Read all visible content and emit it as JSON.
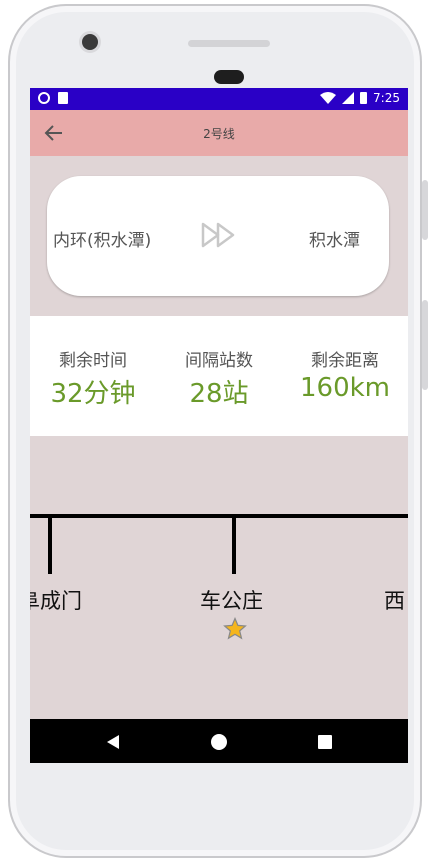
{
  "status_bar": {
    "time": "7:25",
    "icons": [
      "notification-dot-icon",
      "sd-card-icon",
      "wifi-icon",
      "signal-icon",
      "battery-icon"
    ]
  },
  "app_bar": {
    "title": "2号线",
    "back_icon": "arrow-left-icon"
  },
  "route": {
    "from": "内环(积水潭)",
    "to": "积水潭",
    "direction_icon": "fast-forward-icon"
  },
  "stats": [
    {
      "label": "剩余时间",
      "value": "32分钟"
    },
    {
      "label": "间隔站数",
      "value": "28站"
    },
    {
      "label": "剩余距离",
      "value": "160km"
    }
  ],
  "line": {
    "stations": [
      "阜成门",
      "车公庄",
      "西"
    ],
    "current_station_icon": "star-icon"
  },
  "colors": {
    "status_bar": "#2a00c6",
    "app_bar": "#e8aaa9",
    "background": "#e0d5d6",
    "stat_value": "#6a9a2a"
  },
  "nav_bar": {
    "icons": [
      "back-triangle-icon",
      "home-circle-icon",
      "recents-square-icon"
    ]
  }
}
